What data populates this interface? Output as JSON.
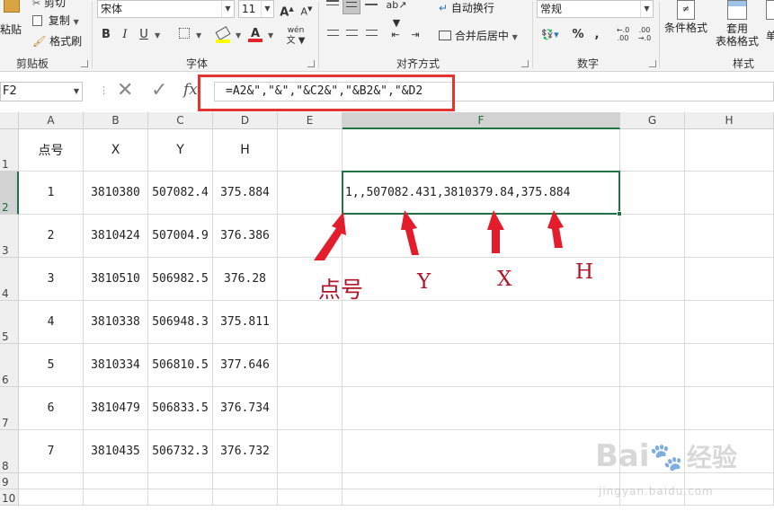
{
  "ribbon": {
    "clipboard": {
      "paste": "粘贴",
      "cut": "剪切",
      "copy": "复制",
      "format_painter": "格式刷",
      "group_label": "剪贴板"
    },
    "font": {
      "name": "宋体",
      "size": "11",
      "group_label": "字体",
      "bold": "B",
      "italic": "I",
      "underline": "U",
      "grow": "A",
      "shrink": "A",
      "phonetic": "wén"
    },
    "alignment": {
      "wrap_text": "自动换行",
      "merge_center": "合并后居中",
      "group_label": "对齐方式"
    },
    "number": {
      "format": "常规",
      "percent": "%",
      "comma": ",",
      "group_label": "数字"
    },
    "styles": {
      "conditional": "条件格式",
      "table_format_line1": "套用",
      "table_format_line2": "表格格式",
      "cell_styles": "单",
      "group_label": "样式"
    }
  },
  "formula_bar": {
    "name_box": "F2",
    "fx": "fx",
    "formula": "=A2&\",\"&\",\"&C2&\",\"&B2&\",\"&D2"
  },
  "columns": [
    "A",
    "B",
    "C",
    "D",
    "E",
    "F",
    "G",
    "H"
  ],
  "rows": [
    "1",
    "2",
    "3",
    "4",
    "5",
    "6",
    "7",
    "8",
    "9",
    "10"
  ],
  "table": {
    "headers": [
      "点号",
      "X",
      "Y",
      "H"
    ],
    "rows": [
      [
        "1",
        "3810380",
        "507082.4",
        "375.884"
      ],
      [
        "2",
        "3810424",
        "507004.9",
        "376.386"
      ],
      [
        "3",
        "3810510",
        "506982.5",
        "376.28"
      ],
      [
        "4",
        "3810338",
        "506948.3",
        "375.811"
      ],
      [
        "5",
        "3810334",
        "506810.5",
        "377.646"
      ],
      [
        "6",
        "3810479",
        "506833.5",
        "376.734"
      ],
      [
        "7",
        "3810435",
        "506732.3",
        "376.732"
      ]
    ]
  },
  "f2_value": "1,,507082.431,3810379.84,375.884",
  "annotations": {
    "point_no": "点号",
    "y": "Y",
    "x": "X",
    "h": "H"
  },
  "watermark": {
    "brand": "Bai",
    "brand_tail": "经验",
    "url": "jingyan.baidu.com"
  },
  "colors": {
    "accent_green": "#217346",
    "annotation_red": "#b0152a",
    "highlight_red": "#e3342f"
  }
}
